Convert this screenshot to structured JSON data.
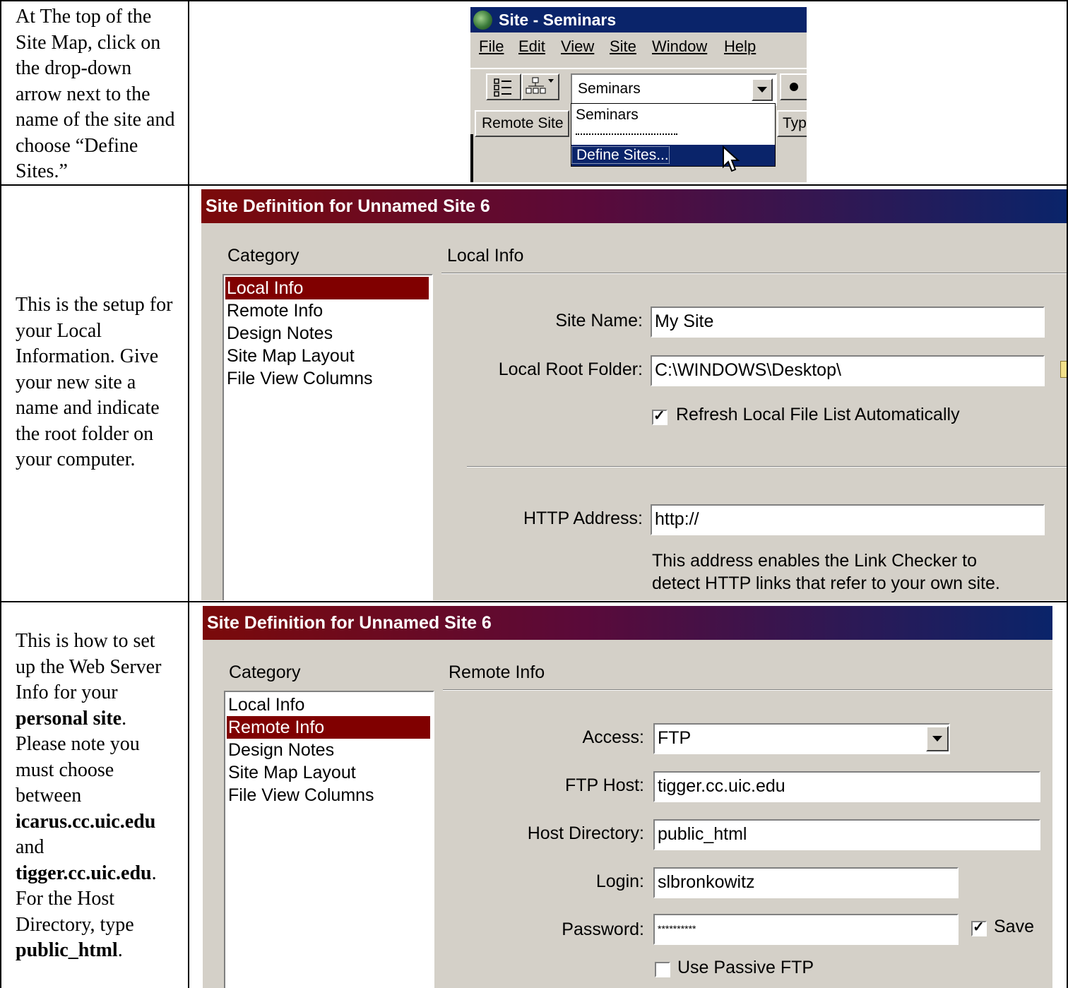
{
  "instructions": {
    "row1": "At The top of the Site Map, click on the drop-down arrow next to the name of the site and choose “Define Sites.”",
    "row2": "This is the setup for your Local Information. Give your new site a name and indicate the root folder on your computer.",
    "row3": {
      "p1": "This is how to set up the Web Server Info for your ",
      "b1": "personal site",
      "p2": ". Please note you must choose between ",
      "b2": "icarus.cc.uic.edu",
      "p3": " and ",
      "b3": "tigger.cc.uic.edu",
      "p4": ". For the Host Directory, type ",
      "b4": "public_html",
      "p5": "."
    }
  },
  "site_window": {
    "title": "Site - Seminars",
    "menu": [
      "File",
      "Edit",
      "View",
      "Site",
      "Window",
      "Help"
    ],
    "combo_value": "Seminars",
    "dropdown_options": [
      "Seminars",
      "Define Sites..."
    ],
    "separator": "----------------------",
    "column_headers": [
      "Remote Site",
      "Typ"
    ]
  },
  "local_dialog": {
    "title": "Site Definition for Unnamed Site 6",
    "category_label": "Category",
    "section_label": "Local Info",
    "categories": [
      "Local Info",
      "Remote Info",
      "Design Notes",
      "Site Map Layout",
      "File View Columns"
    ],
    "selected_category": "Local Info",
    "site_name_label": "Site Name:",
    "site_name_value": "My Site",
    "root_folder_label": "Local Root Folder:",
    "root_folder_value": "C:\\WINDOWS\\Desktop\\",
    "refresh_label": "Refresh Local File List Automatically",
    "refresh_checked": true,
    "http_label": "HTTP Address:",
    "http_value": "http://",
    "http_note_1": "This address enables the Link Checker to",
    "http_note_2": "detect HTTP links that refer to your own site."
  },
  "remote_dialog": {
    "title": "Site Definition for Unnamed Site 6",
    "category_label": "Category",
    "section_label": "Remote Info",
    "categories": [
      "Local Info",
      "Remote Info",
      "Design Notes",
      "Site Map Layout",
      "File View Columns"
    ],
    "selected_category": "Remote Info",
    "access_label": "Access:",
    "access_value": "FTP",
    "ftp_host_label": "FTP Host:",
    "ftp_host_value": "tigger.cc.uic.edu",
    "host_dir_label": "Host Directory:",
    "host_dir_value": "public_html",
    "login_label": "Login:",
    "login_value": "slbronkowitz",
    "password_label": "Password:",
    "password_value": "**********",
    "save_label": "Save",
    "save_checked": true,
    "passive_label": "Use Passive FTP",
    "passive_checked": false
  }
}
